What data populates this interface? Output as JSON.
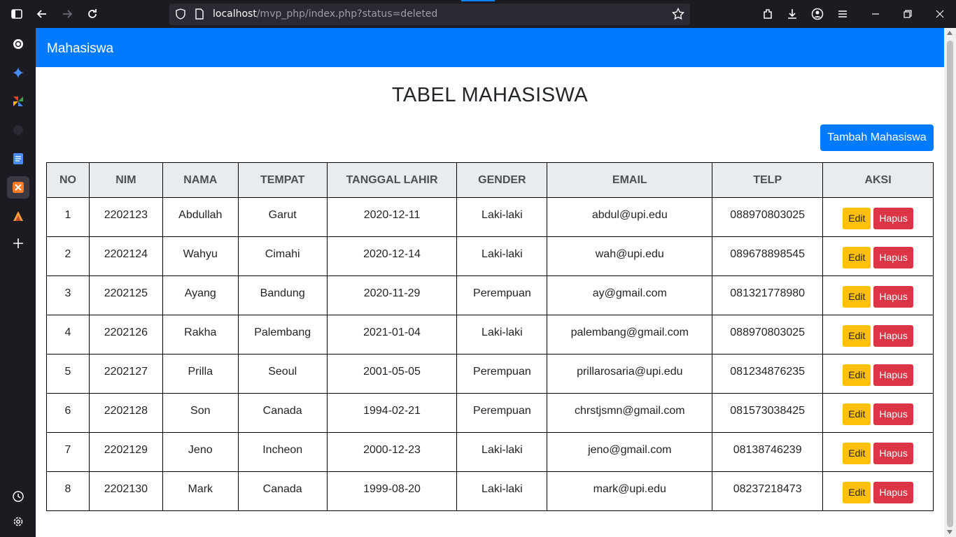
{
  "browser": {
    "url_host": "localhost",
    "url_path": "/mvp_php/index.php?status=deleted",
    "icons": [
      "sidebar-toggle-icon",
      "back-icon",
      "forward-icon",
      "reload-icon",
      "shield-icon",
      "page-icon",
      "star-icon",
      "extensions-icon",
      "download-icon",
      "account-icon",
      "menu-icon",
      "minimize-icon",
      "restore-icon",
      "close-icon"
    ]
  },
  "sidebar": {
    "icons": [
      "chatgpt-icon",
      "gemini-icon",
      "pinwheel-icon",
      "github-icon",
      "docs-icon",
      "xampp-icon",
      "ai-studio-icon",
      "add-icon",
      "history-icon",
      "settings-icon"
    ]
  },
  "navbar": {
    "brand": "Mahasiswa",
    "color": "#007bff"
  },
  "page": {
    "title": "TABEL MAHASISWA",
    "add_button": "Tambah Mahasiswa"
  },
  "table": {
    "headers": [
      "NO",
      "NIM",
      "NAMA",
      "TEMPAT",
      "TANGGAL LAHIR",
      "GENDER",
      "EMAIL",
      "TELP",
      "AKSI"
    ],
    "edit_label": "Edit",
    "delete_label": "Hapus",
    "rows": [
      [
        "1",
        "2202123",
        "Abdullah",
        "Garut",
        "2020-12-11",
        "Laki-laki",
        "abdul@upi.edu",
        "088970803025"
      ],
      [
        "2",
        "2202124",
        "Wahyu",
        "Cimahi",
        "2020-12-14",
        "Laki-laki",
        "wah@upi.edu",
        "089678898545"
      ],
      [
        "3",
        "2202125",
        "Ayang",
        "Bandung",
        "2020-11-29",
        "Perempuan",
        "ay@gmail.com",
        "081321778980"
      ],
      [
        "4",
        "2202126",
        "Rakha",
        "Palembang",
        "2021-01-04",
        "Laki-laki",
        "palembang@gmail.com",
        "088970803025"
      ],
      [
        "5",
        "2202127",
        "Prilla",
        "Seoul",
        "2001-05-05",
        "Perempuan",
        "prillarosaria@upi.edu",
        "081234876235"
      ],
      [
        "6",
        "2202128",
        "Son",
        "Canada",
        "1994-02-21",
        "Perempuan",
        "chrstjsmn@gmail.com",
        "081573038425"
      ],
      [
        "7",
        "2202129",
        "Jeno",
        "Incheon",
        "2000-12-23",
        "Laki-laki",
        "jeno@gmail.com",
        "08138746239"
      ],
      [
        "8",
        "2202130",
        "Mark",
        "Canada",
        "1999-08-20",
        "Laki-laki",
        "mark@upi.edu",
        "08237218473"
      ]
    ]
  },
  "colors": {
    "primary": "#007bff",
    "warning": "#ffc107",
    "danger": "#dc3545",
    "thead": "#e9ecef"
  }
}
